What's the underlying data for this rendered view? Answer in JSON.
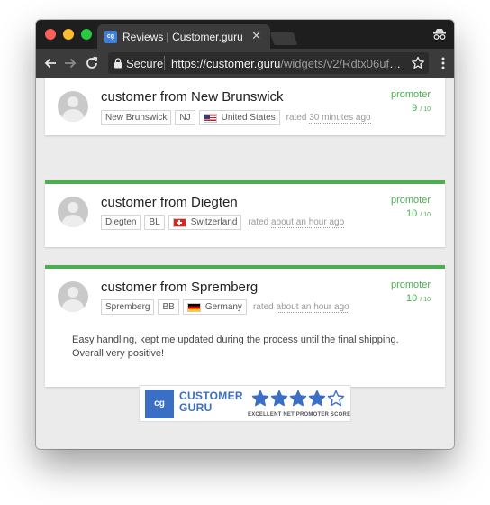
{
  "browser": {
    "tab_title": "Reviews | Customer.guru",
    "tab_favicon_text": "cg",
    "tab_close": "✕",
    "secure_label": "Secure",
    "url_host": "https://customer.guru",
    "url_path": "/widgets/v2/Rdtx06ufg...",
    "colors": {
      "chrome_dark": "#1e1e1e",
      "toolbar": "#3b3b3b",
      "favicon": "#3f7fd7"
    }
  },
  "reviews": [
    {
      "name": "customer from New Brunswick",
      "tags": [
        "New Brunswick",
        "NJ"
      ],
      "country": "United States",
      "rated_prefix": "rated",
      "rated_time": "30 minutes ago",
      "nps_label": "promoter",
      "score": "9",
      "score_max": "/ 10",
      "text": ""
    },
    {
      "name": "customer from Diegten",
      "tags": [
        "Diegten",
        "BL"
      ],
      "country": "Switzerland",
      "rated_prefix": "rated",
      "rated_time": "about an hour ago",
      "nps_label": "promoter",
      "score": "10",
      "score_max": "/ 10",
      "text": ""
    },
    {
      "name": "customer from Spremberg",
      "tags": [
        "Spremberg",
        "BB"
      ],
      "country": "Germany",
      "rated_prefix": "rated",
      "rated_time": "about an hour ago",
      "nps_label": "promoter",
      "score": "10",
      "score_max": "/ 10",
      "text": "Easy handling, kept me updated during the process until the final shipping. Overall very positive!"
    }
  ],
  "badge": {
    "logo_text": "cg",
    "name_line1": "CUSTOMER",
    "name_line2": "GURU",
    "tagline": "EXCELLENT NET PROMOTER SCORE",
    "stars_filled": 4,
    "stars_total": 5,
    "color": "#3b6fc4"
  },
  "colors": {
    "promoter_green": "#4cae4f",
    "page_bg": "#ebebeb"
  },
  "icons": [
    "back-arrow-icon",
    "forward-arrow-icon",
    "reload-icon",
    "lock-icon",
    "star-icon",
    "menu-icon",
    "incognito-icon",
    "avatar-icon",
    "flag-icon"
  ]
}
